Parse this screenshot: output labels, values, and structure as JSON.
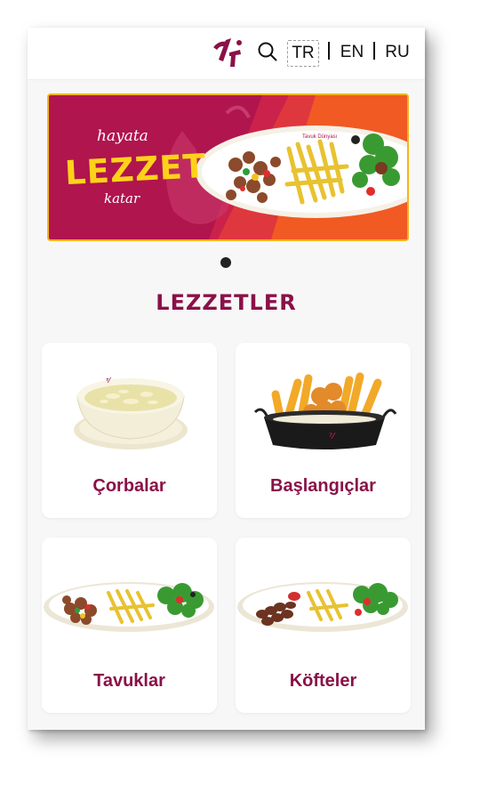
{
  "header": {
    "languages": [
      "TR",
      "EN",
      "RU"
    ],
    "active_language": "TR"
  },
  "banner": {
    "line1": "hayata",
    "line2": "LEZZET",
    "line3": "katar",
    "plate_brand": "Tavuk Dünyası"
  },
  "carousel": {
    "slide_count": 1,
    "active_index": 0
  },
  "section": {
    "title": "LEZZETLER"
  },
  "categories": [
    {
      "label": "Çorbalar",
      "image": "soup-bowl"
    },
    {
      "label": "Başlangıçlar",
      "image": "fries-basket"
    },
    {
      "label": "Tavuklar",
      "image": "chicken-platter"
    },
    {
      "label": "Köfteler",
      "image": "meatball-platter"
    }
  ],
  "colors": {
    "brand": "#8a1147",
    "banner_bg": "#b0154e",
    "banner_accent": "#ffd21a",
    "banner_orange": "#f15a22"
  }
}
